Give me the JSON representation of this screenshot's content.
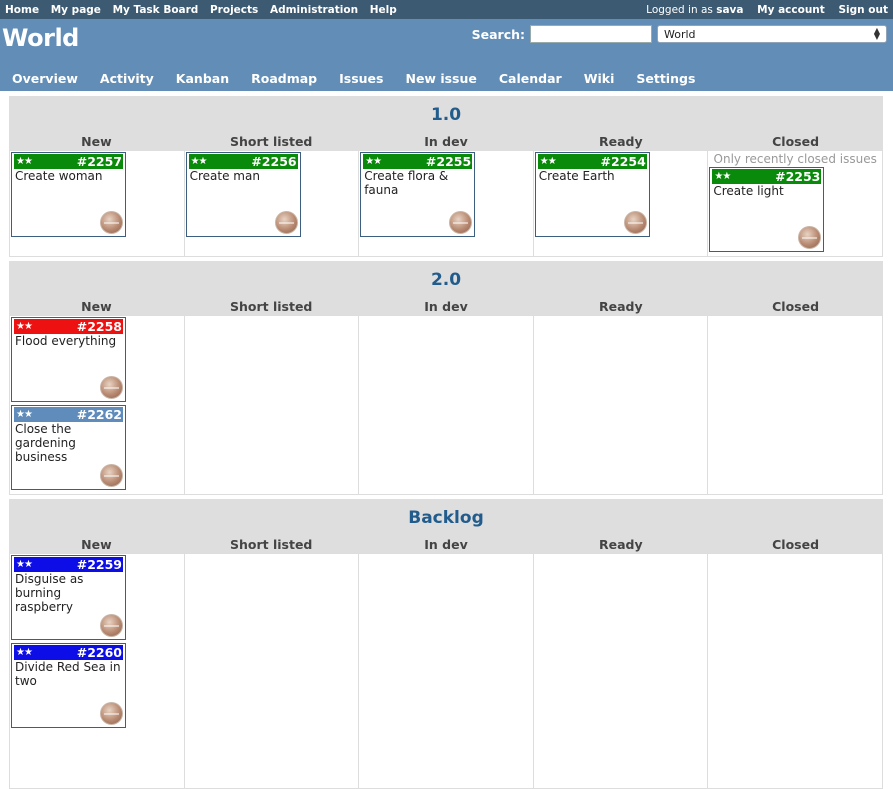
{
  "top_menu": {
    "links": [
      "Home",
      "My page",
      "My Task Board",
      "Projects",
      "Administration",
      "Help"
    ],
    "logged_in_text": "Logged in as",
    "user": "sava",
    "my_account": "My account",
    "sign_out": "Sign out"
  },
  "header": {
    "title": "World",
    "search_label": "Search:",
    "search_value": "",
    "project_selected": "World"
  },
  "main_menu": [
    "Overview",
    "Activity",
    "Kanban",
    "Roadmap",
    "Issues",
    "New issue",
    "Calendar",
    "Wiki",
    "Settings"
  ],
  "columns": [
    "New",
    "Short listed",
    "In dev",
    "Ready",
    "Closed"
  ],
  "closed_hint": "Only recently closed issues",
  "colors": {
    "green": "#0a8a0a",
    "red": "#ee1111",
    "steel": "#5f8cba",
    "blue": "#0d0de8"
  },
  "versions": [
    {
      "name": "1.0",
      "lanes": [
        [
          {
            "id": "#2257",
            "subject": "Create woman",
            "color": "#0a8a0a",
            "stars": "★★"
          }
        ],
        [
          {
            "id": "#2256",
            "subject": "Create man",
            "color": "#0a8a0a",
            "stars": "★★"
          }
        ],
        [
          {
            "id": "#2255",
            "subject": "Create flora & fauna",
            "color": "#0a8a0a",
            "stars": "★★"
          }
        ],
        [
          {
            "id": "#2254",
            "subject": "Create Earth",
            "color": "#0a8a0a",
            "stars": "★★"
          }
        ],
        [
          {
            "id": "#2253",
            "subject": "Create light",
            "color": "#0a8a0a",
            "stars": "★★"
          }
        ]
      ]
    },
    {
      "name": "2.0",
      "lanes": [
        [
          {
            "id": "#2258",
            "subject": "Flood everything",
            "color": "#ee1111",
            "stars": "★★"
          },
          {
            "id": "#2262",
            "subject": "Close the gardening business",
            "color": "#5f8cba",
            "stars": "★★"
          }
        ],
        [],
        [],
        [],
        []
      ]
    },
    {
      "name": "Backlog",
      "lanes": [
        [
          {
            "id": "#2259",
            "subject": "Disguise as burning raspberry",
            "color": "#0d0de8",
            "stars": "★★"
          },
          {
            "id": "#2260",
            "subject": "Divide Red Sea in two",
            "color": "#0d0de8",
            "stars": "★★"
          }
        ],
        [],
        [],
        [],
        []
      ]
    }
  ]
}
